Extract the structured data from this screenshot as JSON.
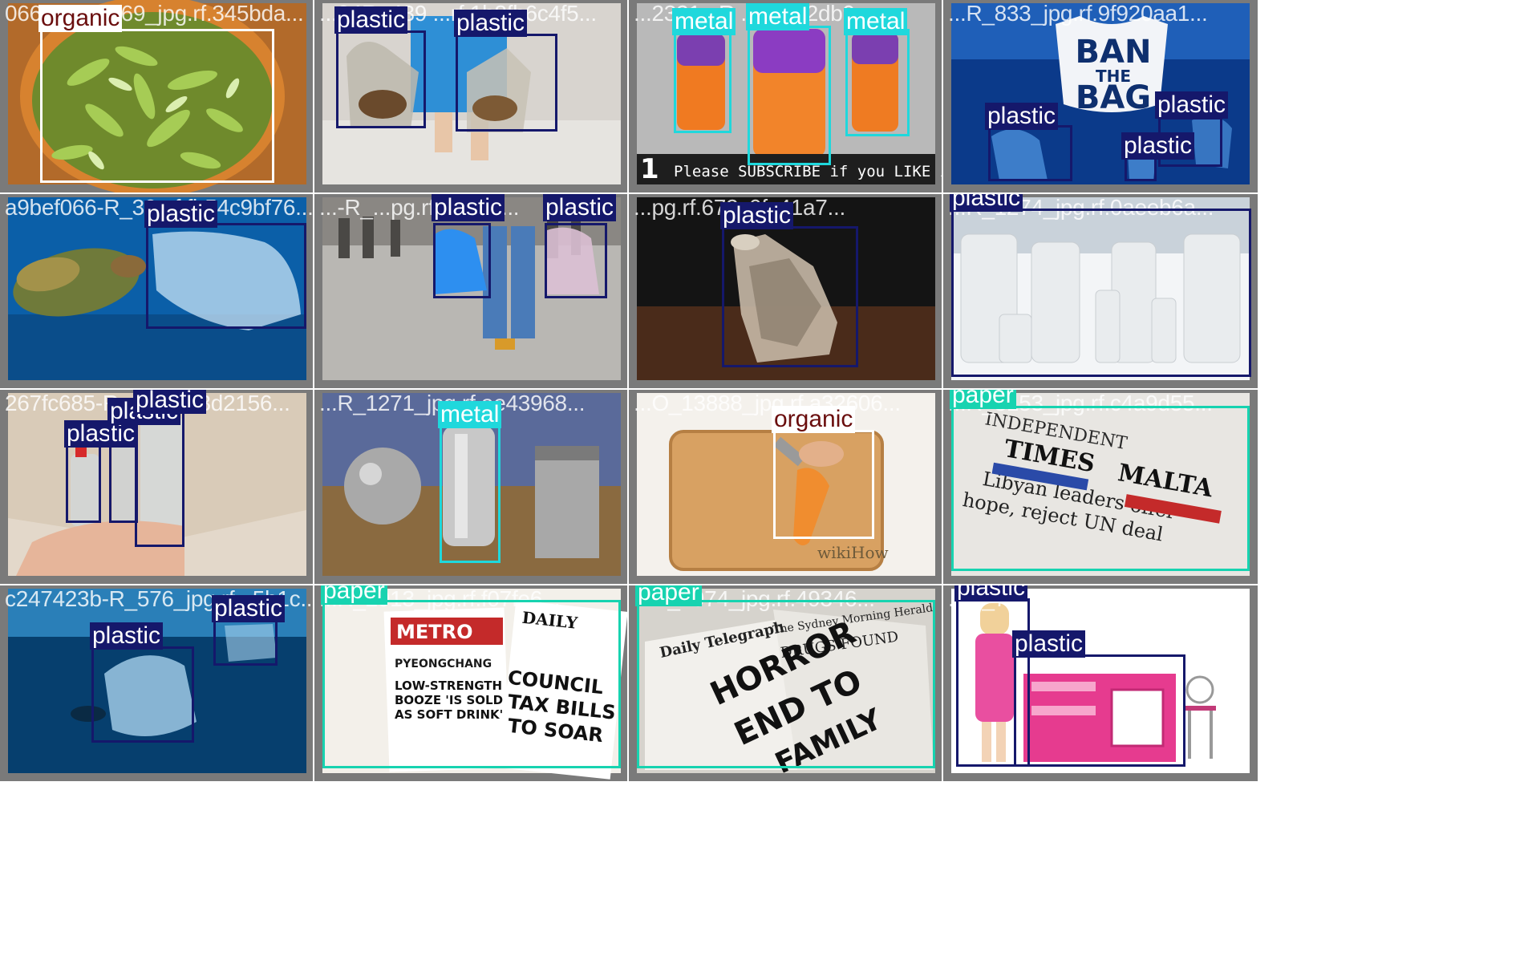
{
  "classes": {
    "plastic": {
      "color": "#15186b"
    },
    "metal": {
      "color": "#1fd8dc"
    },
    "paper": {
      "color": "#17d3b0"
    },
    "organic": {
      "color": "#ffffff",
      "text_color": "#6a0e0e"
    }
  },
  "tiles": [
    {
      "file_name": "066...0_13769_jpg.rf.345bda...",
      "scene": "salad-bowl",
      "detections": [
        "organic"
      ]
    },
    {
      "file_name": "...04R_439 ...rf.1b8fb6c4f5...",
      "scene": "plastic-bags",
      "detections": [
        "plastic",
        "plastic"
      ]
    },
    {
      "file_name": "...2321...R ...jpg...2db9...",
      "scene": "soda-cans",
      "overlay_text": "Please SUBSCRIBE if you LIKE it...",
      "overlay_number": "1",
      "detections": [
        "metal",
        "metal",
        "metal"
      ]
    },
    {
      "file_name": "...R_833_jpg.rf.9f920aa1...",
      "scene": "ban-the-bag",
      "poster_lines": [
        "BAN",
        "THE",
        "BAG"
      ],
      "detections": [
        "plastic",
        "plastic",
        "plastic"
      ]
    },
    {
      "file_name": "a9bef066-R_30...f.fb54c9bf76...",
      "scene": "turtle-bag",
      "detections": [
        "plastic"
      ]
    },
    {
      "file_name": "...-R_...pg.rf.4...fe2...",
      "scene": "street-bags",
      "detections": [
        "plastic",
        "plastic"
      ]
    },
    {
      "file_name": "...pg.rf.672c0fc41a7...",
      "scene": "crushed-bottle",
      "detections": [
        "plastic"
      ]
    },
    {
      "file_name": "...R_1274_jpg.rf.0aeeb6a...",
      "scene": "white-bottles",
      "detections": [
        "plastic"
      ]
    },
    {
      "file_name": "267fc685-R...g.rf.2e3d2156...",
      "scene": "pet-bottles",
      "detections": [
        "plastic",
        "plastic",
        "plastic"
      ]
    },
    {
      "file_name": "...R_1271_jpg.rf.ae43968...",
      "scene": "aluminium-objects",
      "detections": [
        "metal"
      ]
    },
    {
      "file_name": "...O_13888_jpg.rf.a32606...",
      "scene": "carrot-board",
      "overlay_text": "wikiHow",
      "detections": [
        "organic"
      ]
    },
    {
      "file_name": "...R_3153_jpg.rf.c4a9d55...",
      "scene": "times-of-malta",
      "newspaper_lines": [
        "INDEPENDENT",
        "TIMES",
        "MALTA",
        "Libyan leaders offer",
        "hope, reject UN deal"
      ],
      "detections": [
        "paper"
      ]
    },
    {
      "file_name": "c247423b-R_576_jpg.rf...5b1c...",
      "scene": "underwater-bags",
      "detections": [
        "plastic",
        "plastic"
      ]
    },
    {
      "file_name": "...R_2913_jpg.rf.f07fe6...",
      "scene": "metro-papers",
      "newspaper_lines": [
        "METRO",
        "PYEONGCHANG",
        "LOW-STRENGTH",
        "BOOZE 'IS SOLD",
        "AS SOFT DRINK'",
        "DAILY",
        "COUNCIL",
        "TAX BILLS",
        "TO SOAR"
      ],
      "detections": [
        "paper"
      ]
    },
    {
      "file_name": "...R_2974_jpg.rf.49346...",
      "scene": "telegraph-stack",
      "newspaper_lines": [
        "Daily Telegraph",
        "The Sydney Morning Herald",
        "DRUGS FOUND",
        "HORROR",
        "END TO",
        "FAMILY"
      ],
      "detections": [
        "paper"
      ]
    },
    {
      "file_name": "...R_793_jpg.rf.9fdc4bbfed...",
      "scene": "doll-kitchen",
      "detections": [
        "plastic",
        "plastic"
      ]
    }
  ]
}
